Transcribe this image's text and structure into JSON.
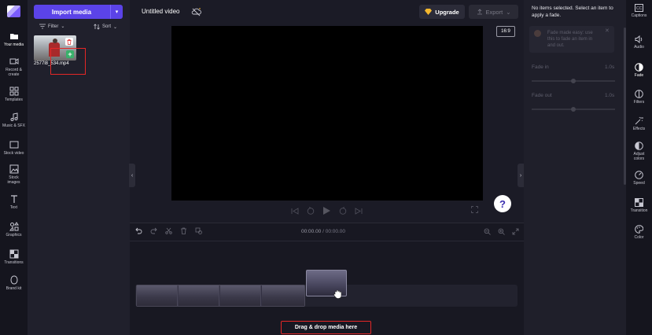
{
  "left_rail": {
    "items": [
      {
        "label": "Your media",
        "icon": "folder-icon"
      },
      {
        "label": "Record &\ncreate",
        "icon": "video-camera-icon"
      },
      {
        "label": "Templates",
        "icon": "grid-icon"
      },
      {
        "label": "Music & SFX",
        "icon": "music-note-icon"
      },
      {
        "label": "Stock video",
        "icon": "film-icon"
      },
      {
        "label": "Stock\nimages",
        "icon": "image-icon"
      },
      {
        "label": "Text",
        "icon": "text-icon"
      },
      {
        "label": "Graphics",
        "icon": "shapes-icon"
      },
      {
        "label": "Transitions",
        "icon": "transitions-icon"
      },
      {
        "label": "Brand kit",
        "icon": "brand-kit-icon"
      }
    ]
  },
  "media_panel": {
    "import_label": "Import media",
    "filter_label": "Filter",
    "sort_label": "Sort",
    "file_name": "2577l8_534.mp4"
  },
  "topbar": {
    "title": "Untitled video",
    "upgrade_label": "Upgrade",
    "export_label": "Export"
  },
  "preview": {
    "aspect_ratio": "16:9",
    "help_label": "?"
  },
  "timeline": {
    "current_time": "00:00.00",
    "separator": " / ",
    "total_time": "00:00.00",
    "drop_label": "Drag & drop media here"
  },
  "properties": {
    "no_selection": "No items selected. Select an item to apply a fade.",
    "tip": "Fade made easy: use this to fade an item in and out.",
    "fade_in_label": "Fade in",
    "fade_in_value": "1.0s",
    "fade_out_label": "Fade out",
    "fade_out_value": "1.0s"
  },
  "right_rail": {
    "items": [
      {
        "label": "Captions",
        "icon": "captions-icon"
      },
      {
        "label": "Audio",
        "icon": "speaker-icon"
      },
      {
        "label": "Fade",
        "icon": "fade-icon"
      },
      {
        "label": "Filters",
        "icon": "filters-icon"
      },
      {
        "label": "Effects",
        "icon": "magic-wand-icon"
      },
      {
        "label": "Adjust\ncolors",
        "icon": "adjust-colors-icon"
      },
      {
        "label": "Speed",
        "icon": "speedometer-icon"
      },
      {
        "label": "Transition",
        "icon": "transition-icon"
      },
      {
        "label": "Color",
        "icon": "palette-icon"
      }
    ]
  },
  "colors": {
    "accent": "#5b43e8",
    "highlight": "#e52727",
    "add": "#39b06a"
  }
}
